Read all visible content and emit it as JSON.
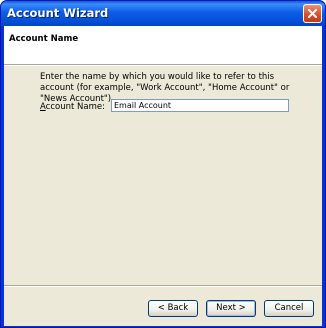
{
  "window": {
    "title": "Account Wizard"
  },
  "header": {
    "title": "Account Name"
  },
  "body": {
    "instructions": "Enter the name by which you would like to refer to this account (for example, \"Work Account\", \"Home Account\" or \"News Account\").",
    "field_label_mnemonic": "A",
    "field_label_rest": "ccount Name:",
    "field_value": "Email Account"
  },
  "buttons": {
    "back": "< Back",
    "next": "Next >",
    "cancel": "Cancel"
  },
  "icons": {
    "close": "close-icon"
  },
  "colors": {
    "titlebar": "#0554dd",
    "client": "#ece9d8",
    "close": "#d9512d"
  }
}
